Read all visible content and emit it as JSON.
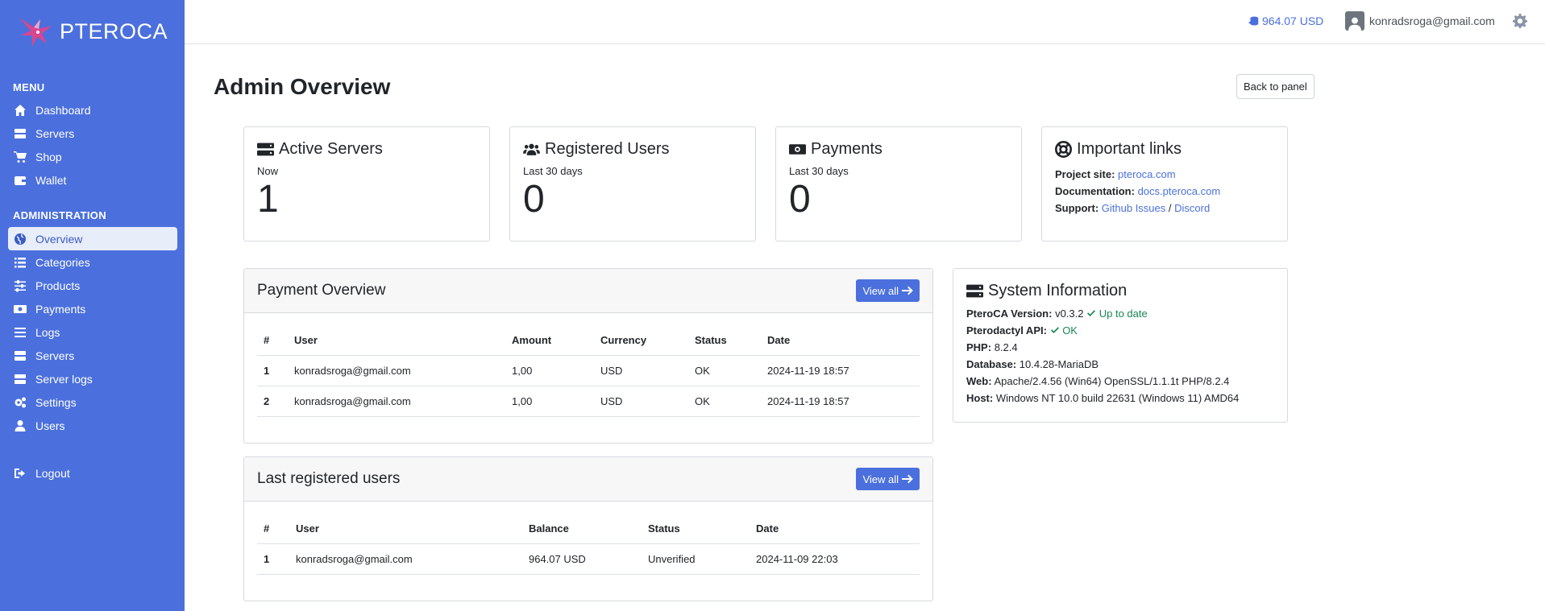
{
  "brand": {
    "name": "PTEROCA"
  },
  "sidebar": {
    "menu_title": "MENU",
    "menu": [
      {
        "label": "Dashboard",
        "icon": "home-icon"
      },
      {
        "label": "Servers",
        "icon": "server-icon"
      },
      {
        "label": "Shop",
        "icon": "cart-icon"
      },
      {
        "label": "Wallet",
        "icon": "wallet-icon"
      }
    ],
    "admin_title": "ADMINISTRATION",
    "admin": [
      {
        "label": "Overview",
        "icon": "globe-icon",
        "active": true
      },
      {
        "label": "Categories",
        "icon": "list-icon"
      },
      {
        "label": "Products",
        "icon": "sliders-icon"
      },
      {
        "label": "Payments",
        "icon": "money-icon"
      },
      {
        "label": "Logs",
        "icon": "lines-icon"
      },
      {
        "label": "Servers",
        "icon": "server-icon"
      },
      {
        "label": "Server logs",
        "icon": "server-icon"
      },
      {
        "label": "Settings",
        "icon": "gears-icon"
      },
      {
        "label": "Users",
        "icon": "user-icon"
      }
    ],
    "logout": "Logout"
  },
  "topbar": {
    "balance": "964.07 USD",
    "user_email": "konradsroga@gmail.com"
  },
  "page": {
    "title": "Admin Overview",
    "back_button": "Back to panel"
  },
  "stats": {
    "active_servers": {
      "title": "Active Servers",
      "sub": "Now",
      "value": "1"
    },
    "registered_users": {
      "title": "Registered Users",
      "sub": "Last 30 days",
      "value": "0"
    },
    "payments": {
      "title": "Payments",
      "sub": "Last 30 days",
      "value": "0"
    }
  },
  "links": {
    "title": "Important links",
    "project_label": "Project site:",
    "project_link": "pteroca.com",
    "docs_label": "Documentation:",
    "docs_link": "docs.pteroca.com",
    "support_label": "Support:",
    "support_link1": "Github Issues",
    "support_sep": "/",
    "support_link2": "Discord"
  },
  "payment_overview": {
    "title": "Payment Overview",
    "view_all": "View all",
    "columns": [
      "#",
      "User",
      "Amount",
      "Currency",
      "Status",
      "Date"
    ],
    "rows": [
      [
        "1",
        "konradsroga@gmail.com",
        "1,00",
        "USD",
        "OK",
        "2024-11-19 18:57"
      ],
      [
        "2",
        "konradsroga@gmail.com",
        "1,00",
        "USD",
        "OK",
        "2024-11-19 18:57"
      ]
    ]
  },
  "last_users": {
    "title": "Last registered users",
    "view_all": "View all",
    "columns": [
      "#",
      "User",
      "Balance",
      "Status",
      "Date"
    ],
    "rows": [
      [
        "1",
        "konradsroga@gmail.com",
        "964.07 USD",
        "Unverified",
        "2024-11-09 22:03"
      ]
    ]
  },
  "system": {
    "title": "System Information",
    "pteroca_label": "PteroCA Version:",
    "pteroca_value": "v0.3.2",
    "pteroca_status": "Up to date",
    "api_label": "Pterodactyl API:",
    "api_status": "OK",
    "php_label": "PHP:",
    "php_value": "8.2.4",
    "db_label": "Database:",
    "db_value": "10.4.28-MariaDB",
    "web_label": "Web:",
    "web_value": "Apache/2.4.56 (Win64) OpenSSL/1.1.1t PHP/8.2.4",
    "host_label": "Host:",
    "host_value": "Windows NT 10.0 build 22631 (Windows 11) AMD64"
  },
  "colors": {
    "sidebar": "#4b70dd",
    "accent": "#4b70dd",
    "ok": "#198754"
  }
}
